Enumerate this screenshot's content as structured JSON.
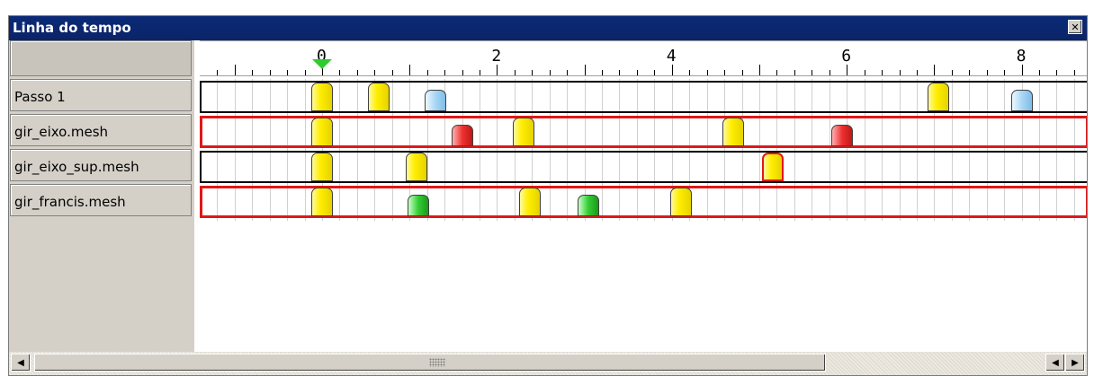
{
  "window": {
    "title": "Linha do tempo",
    "close_icon": "close-icon"
  },
  "ruler": {
    "labels": [
      "0",
      "2",
      "4",
      "6",
      "8"
    ],
    "playhead_time": 0
  },
  "tracks": [
    {
      "name": "Passo 1",
      "selected": false,
      "keys": [
        {
          "time": 0.0,
          "color": "yellow"
        },
        {
          "time": 0.65,
          "color": "yellow"
        },
        {
          "time": 1.3,
          "color": "blue",
          "small": true
        },
        {
          "time": 7.05,
          "color": "yellow"
        },
        {
          "time": 8.0,
          "color": "blue",
          "small": true
        }
      ]
    },
    {
      "name": "gir_eixo.mesh",
      "selected": true,
      "keys": [
        {
          "time": 0.0,
          "color": "yellow"
        },
        {
          "time": 1.6,
          "color": "red",
          "small": true
        },
        {
          "time": 2.3,
          "color": "yellow"
        },
        {
          "time": 4.7,
          "color": "yellow"
        },
        {
          "time": 5.95,
          "color": "red",
          "small": true
        }
      ]
    },
    {
      "name": "gir_eixo_sup.mesh",
      "selected": false,
      "keys": [
        {
          "time": 0.0,
          "color": "yellow"
        },
        {
          "time": 1.08,
          "color": "yellow"
        },
        {
          "time": 5.15,
          "color": "yellow",
          "selected": true
        }
      ]
    },
    {
      "name": "gir_francis.mesh",
      "selected": true,
      "keys": [
        {
          "time": 0.0,
          "color": "yellow"
        },
        {
          "time": 1.1,
          "color": "green",
          "small": true
        },
        {
          "time": 2.38,
          "color": "yellow"
        },
        {
          "time": 3.05,
          "color": "green",
          "small": true
        },
        {
          "time": 4.1,
          "color": "yellow"
        }
      ]
    }
  ],
  "colors": {
    "title_bar": "#0a2a78",
    "selected_track_border": "#e01818",
    "playhead": "#2ecc2e"
  },
  "scrollbar": {
    "left_icon": "arrow-left-icon",
    "right_icon": "arrow-right-icon"
  }
}
